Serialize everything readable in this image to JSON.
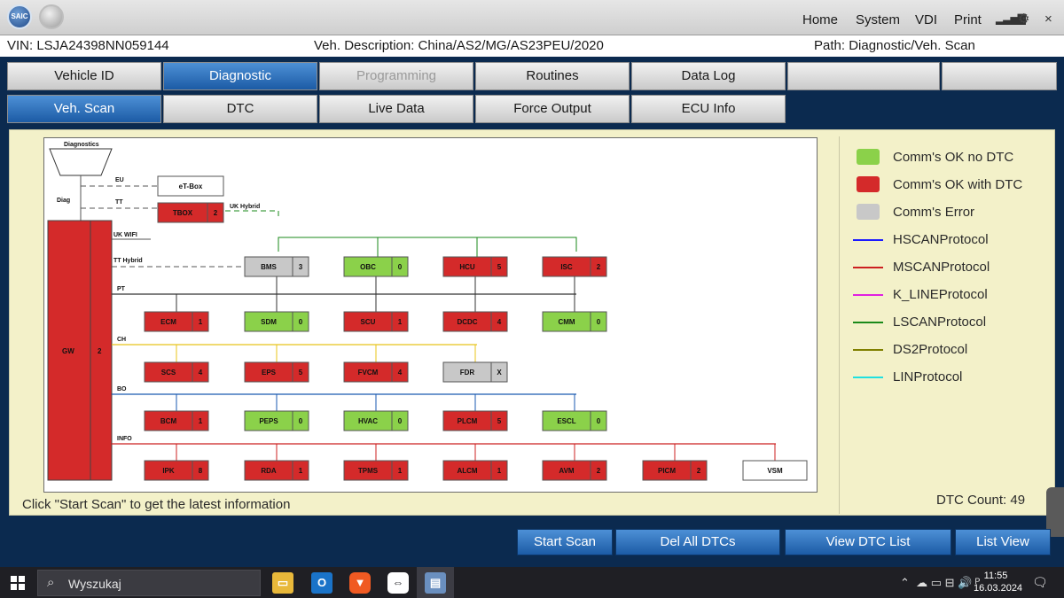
{
  "titlebar": {
    "logo_text": "SAIC",
    "menu": [
      "Home",
      "System",
      "VDI",
      "Print"
    ],
    "signal_icon": "signal-icon",
    "settings_icon": "gear-icon",
    "close_label": "×"
  },
  "info": {
    "vin": "VIN:  LSJA24398NN059144",
    "description": "Veh. Description:  China/AS2/MG/AS23PEU/2020",
    "path": "Path:  Diagnostic/Veh. Scan"
  },
  "tabs": {
    "primary": [
      {
        "label": "Vehicle ID",
        "state": "normal"
      },
      {
        "label": "Diagnostic",
        "state": "active"
      },
      {
        "label": "Programming",
        "state": "disabled"
      },
      {
        "label": "Routines",
        "state": "normal"
      },
      {
        "label": "Data Log",
        "state": "normal"
      },
      {
        "label": "",
        "state": "normal"
      },
      {
        "label": "",
        "state": "normal"
      }
    ],
    "secondary": [
      {
        "label": "Veh. Scan",
        "state": "active"
      },
      {
        "label": "DTC",
        "state": "normal"
      },
      {
        "label": "Live Data",
        "state": "normal"
      },
      {
        "label": "Force Output",
        "state": "normal"
      },
      {
        "label": "ECU Info",
        "state": "normal"
      }
    ]
  },
  "diagram": {
    "diagnostics_label": "Diagnostics",
    "diag_label": "Diag",
    "gateway": {
      "name": "GW",
      "code": "2"
    },
    "bus_labels": {
      "eu": "EU",
      "tt": "TT",
      "uk_hybrid": "UK  Hybrid",
      "uk_wifi": "UK  WIFI",
      "tt_hybrid": "TT  Hybrid",
      "pt": "PT",
      "ch": "CH",
      "bo": "BO",
      "info": "INFO"
    },
    "modules": [
      {
        "name": "eT-Box",
        "code": "",
        "status": "none"
      },
      {
        "name": "TBOX",
        "code": "2",
        "status": "dtc"
      },
      {
        "name": "BMS",
        "code": "3",
        "status": "error"
      },
      {
        "name": "OBC",
        "code": "0",
        "status": "ok"
      },
      {
        "name": "HCU",
        "code": "5",
        "status": "dtc"
      },
      {
        "name": "ISC",
        "code": "2",
        "status": "dtc"
      },
      {
        "name": "ECM",
        "code": "1",
        "status": "dtc"
      },
      {
        "name": "SDM",
        "code": "0",
        "status": "ok"
      },
      {
        "name": "SCU",
        "code": "1",
        "status": "dtc"
      },
      {
        "name": "DCDC",
        "code": "4",
        "status": "dtc"
      },
      {
        "name": "CMM",
        "code": "0",
        "status": "ok"
      },
      {
        "name": "SCS",
        "code": "4",
        "status": "dtc"
      },
      {
        "name": "EPS",
        "code": "5",
        "status": "dtc"
      },
      {
        "name": "FVCM",
        "code": "4",
        "status": "dtc"
      },
      {
        "name": "FDR",
        "code": "X",
        "status": "error"
      },
      {
        "name": "BCM",
        "code": "1",
        "status": "dtc"
      },
      {
        "name": "PEPS",
        "code": "0",
        "status": "ok"
      },
      {
        "name": "HVAC",
        "code": "0",
        "status": "ok"
      },
      {
        "name": "PLCM",
        "code": "5",
        "status": "dtc"
      },
      {
        "name": "ESCL",
        "code": "0",
        "status": "ok"
      },
      {
        "name": "IPK",
        "code": "8",
        "status": "dtc"
      },
      {
        "name": "RDA",
        "code": "1",
        "status": "dtc"
      },
      {
        "name": "TPMS",
        "code": "1",
        "status": "dtc"
      },
      {
        "name": "ALCM",
        "code": "1",
        "status": "dtc"
      },
      {
        "name": "AVM",
        "code": "2",
        "status": "dtc"
      },
      {
        "name": "PICM",
        "code": "2",
        "status": "dtc"
      },
      {
        "name": "VSM",
        "code": "",
        "status": "none"
      }
    ]
  },
  "legend": {
    "status_items": [
      {
        "label": "Comm's OK no DTC",
        "color": "#8bd14a"
      },
      {
        "label": "Comm's OK with DTC",
        "color": "#d42a2a"
      },
      {
        "label": "Comm's Error",
        "color": "#c8c8c8"
      }
    ],
    "protocol_items": [
      {
        "label": "HSCANProtocol",
        "color": "#1a1aff"
      },
      {
        "label": "MSCANProtocol",
        "color": "#cc2020"
      },
      {
        "label": "K_LINEProtocol",
        "color": "#e020e0"
      },
      {
        "label": "LSCANProtocol",
        "color": "#1a8a1a"
      },
      {
        "label": "DS2Protocol",
        "color": "#808000"
      },
      {
        "label": "LINProtocol",
        "color": "#20e0e0"
      }
    ]
  },
  "status_message": "Click \"Start Scan\" to get the latest information",
  "dtc_count": "DTC Count:  49",
  "buttons": {
    "start_scan": "Start Scan",
    "del_all_dtcs": "Del All DTCs",
    "view_dtc_list": "View DTC List",
    "list_view": "List View"
  },
  "taskbar": {
    "search_placeholder": "Wyszukaj",
    "apps": [
      "file-explorer-icon",
      "outlook-icon",
      "brave-browser-icon",
      "teamviewer-icon",
      "diagnostic-app-icon"
    ],
    "time": "11:55",
    "date": "16.03.2024"
  },
  "colors": {
    "ok": "#8bd14a",
    "dtc": "#d42a2a",
    "error": "#c8c8c8",
    "accent": "#1c5ba5",
    "panel": "#f3f1c9"
  }
}
